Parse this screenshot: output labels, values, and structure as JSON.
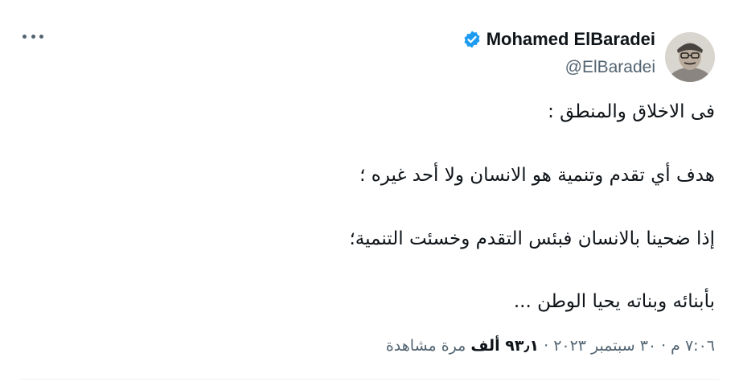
{
  "author": {
    "display_name": "Mohamed ElBaradei",
    "handle": "@ElBaradei",
    "verified_icon": "verified-badge-icon",
    "avatar_icon": "avatar-photo"
  },
  "tweet": {
    "lines": [
      "فى الاخلاق والمنطق :",
      "هدف أي تقدم وتنمية هو الانسان ولا أحد غيره ؛",
      "إذا ضحينا بالانسان فبئس التقدم وخسئت التنمية؛",
      "بأبنائه وبناته يحيا الوطن  ..."
    ]
  },
  "meta": {
    "time": "٧:٠٦ م",
    "separator": "·",
    "date": "٣٠ سبتمبر ٢٠٢٣",
    "views_count": "٩٣٫١ ألف",
    "views_label": "مرة مشاهدة"
  },
  "colors": {
    "text": "#0f1419",
    "muted": "#536471",
    "verified": "#1d9bf0"
  },
  "icons": {
    "more": "more-options-icon"
  }
}
